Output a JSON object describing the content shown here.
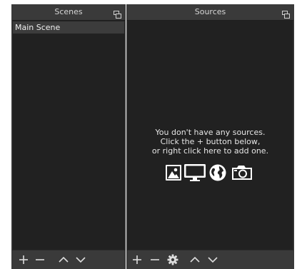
{
  "scenes": {
    "title": "Scenes",
    "items": [
      {
        "label": "Main Scene",
        "selected": true
      }
    ],
    "toolbar": [
      "add-icon",
      "remove-icon",
      "move-up-icon",
      "move-down-icon"
    ]
  },
  "sources": {
    "title": "Sources",
    "empty_lines": [
      "You don't have any sources.",
      "Click the + button below,",
      "or right click here to add one."
    ],
    "empty_icons": [
      "image-icon",
      "display-icon",
      "globe-icon",
      "camera-icon"
    ],
    "toolbar": [
      "add-icon",
      "remove-icon",
      "gear-icon",
      "move-up-icon",
      "move-down-icon"
    ]
  },
  "colors": {
    "panel_bg": "#212121",
    "title_bg": "#3a3a3a",
    "selected_row": "#3c3c3c",
    "text": "#e6e6e6"
  }
}
